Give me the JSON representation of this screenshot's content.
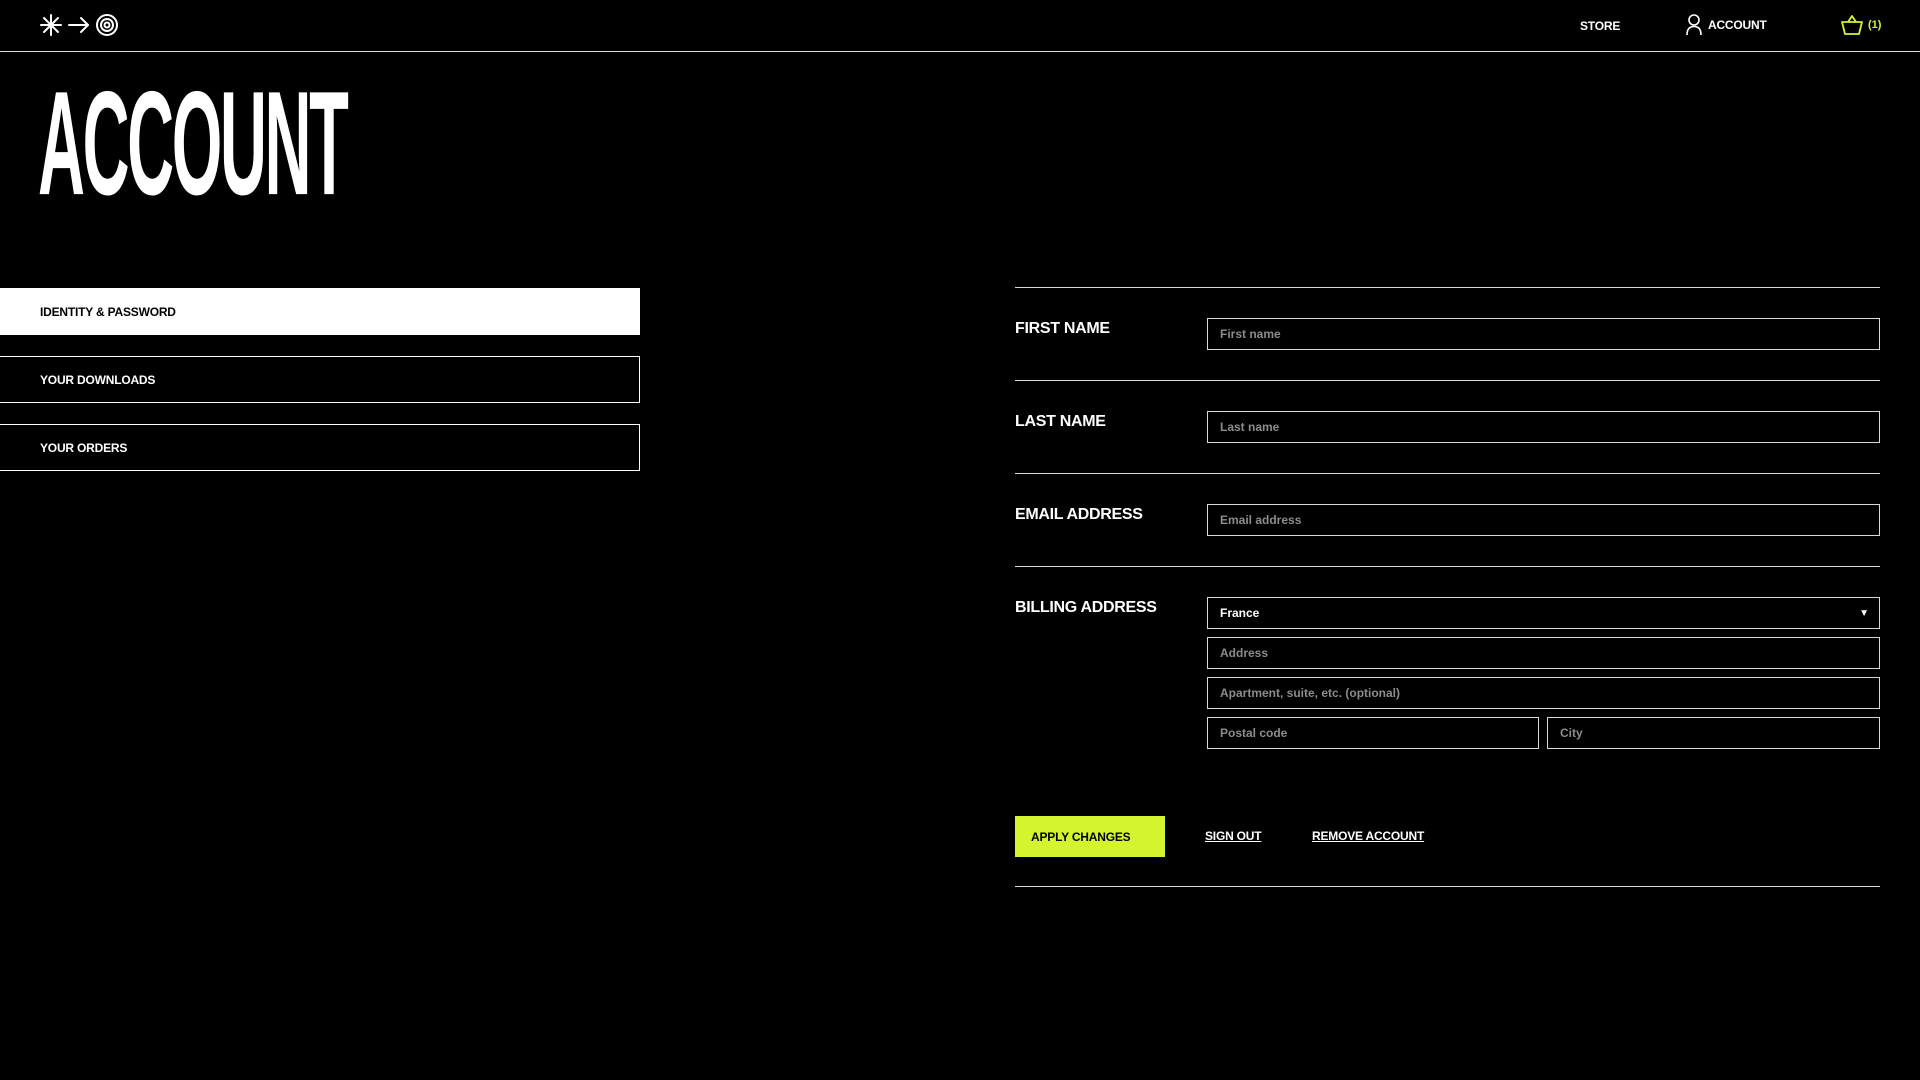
{
  "header": {
    "logo_icons": [
      "asterisk-icon",
      "arrow-right-icon",
      "target-icon"
    ],
    "nav": {
      "store": "STORE",
      "account": "ACCOUNT",
      "cart_count": "(1)"
    },
    "accent_color": "#d4f52e"
  },
  "page": {
    "title": "ACCOUNT"
  },
  "sidebar": {
    "items": [
      {
        "label": "IDENTITY & PASSWORD",
        "active": true
      },
      {
        "label": "YOUR DOWNLOADS",
        "active": false
      },
      {
        "label": "YOUR ORDERS",
        "active": false
      }
    ]
  },
  "form": {
    "first_name": {
      "label": "FIRST NAME",
      "placeholder": "First name",
      "value": ""
    },
    "last_name": {
      "label": "LAST NAME",
      "placeholder": "Last name",
      "value": ""
    },
    "email": {
      "label": "EMAIL ADDRESS",
      "placeholder": "Email address",
      "value": ""
    },
    "billing": {
      "label": "BILLING ADDRESS",
      "country": "France",
      "address_placeholder": "Address",
      "apartment_placeholder": "Apartment, suite, etc. (optional)",
      "postal_placeholder": "Postal code",
      "city_placeholder": "City"
    },
    "actions": {
      "apply": "APPLY CHANGES",
      "sign_out": "SIGN OUT",
      "remove": "REMOVE ACCOUNT"
    }
  }
}
